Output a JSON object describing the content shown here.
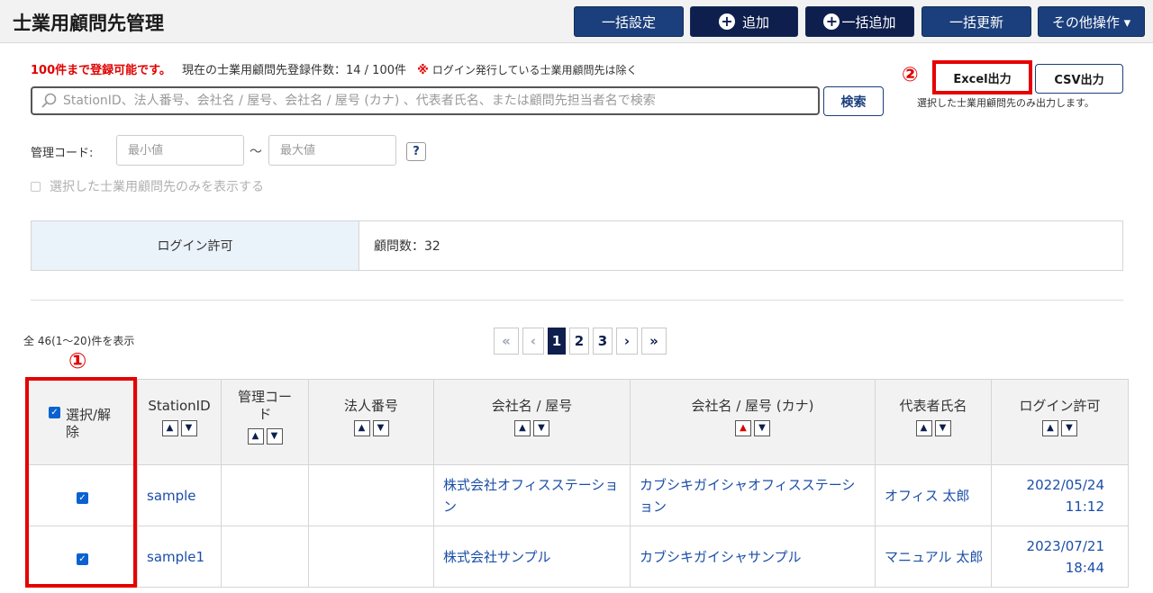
{
  "header": {
    "title": "士業用顧問先管理",
    "buttons": {
      "bulk_setting": "一括設定",
      "add": "追加",
      "bulk_add": "一括追加",
      "bulk_update": "一括更新",
      "other_ops": "その他操作 ▾"
    }
  },
  "limits": {
    "red_text": "100件まで登録可能です。",
    "current_count_text": "現在の士業用顧問先登録件数：14 / 100件",
    "note_mark": "※",
    "note_text": "ログイン発行している士業用顧問先は除く"
  },
  "search": {
    "placeholder": "StationID、法人番号、会社名 / 屋号、会社名 / 屋号 (カナ) 、代表者氏名、または顧問先担当者名で検索",
    "button": "検索"
  },
  "export": {
    "marker": "②",
    "excel": "Excel出力",
    "csv": "CSV出力",
    "note": "選択した士業用顧問先のみ出力します。"
  },
  "filters": {
    "code_label": "管理コード:",
    "min_placeholder": "最小値",
    "tilde": "〜",
    "max_placeholder": "最大値",
    "help": "?",
    "only_selected": "選択した士業用顧問先のみを表示する"
  },
  "summary": {
    "left": "ログイン許可",
    "right": "顧問数：32"
  },
  "list": {
    "count_text": "全 46(1〜20)件を表示",
    "marker": "①",
    "pager": {
      "first": "«",
      "prev": "‹",
      "pages": [
        "1",
        "2",
        "3"
      ],
      "next": "›",
      "last": "»"
    },
    "headers": {
      "select": "選択/解除",
      "station_id": "StationID",
      "code": "管理コード",
      "corp_no": "法人番号",
      "company": "会社名 / 屋号",
      "company_kana": "会社名 / 屋号 (カナ)",
      "representative": "代表者氏名",
      "login": "ログイン許可"
    },
    "rows": [
      {
        "station_id": "sample",
        "code": "",
        "corp_no": "",
        "company": "株式会社オフィスステーション",
        "company_kana": "カブシキガイシャオフィスステーション",
        "representative": "オフィス 太郎",
        "date": "2022/05/24",
        "time": "11:12"
      },
      {
        "station_id": "sample1",
        "code": "",
        "corp_no": "",
        "company": "株式会社サンプル",
        "company_kana": "カブシキガイシャサンプル",
        "representative": "マニュアル 太郎",
        "date": "2023/07/21",
        "time": "18:44"
      }
    ]
  },
  "colors": {
    "navy": "#1b3f7c",
    "dark_navy": "#0e1f4d",
    "highlight_red": "#e60000",
    "link_blue": "#1b4ea8"
  }
}
